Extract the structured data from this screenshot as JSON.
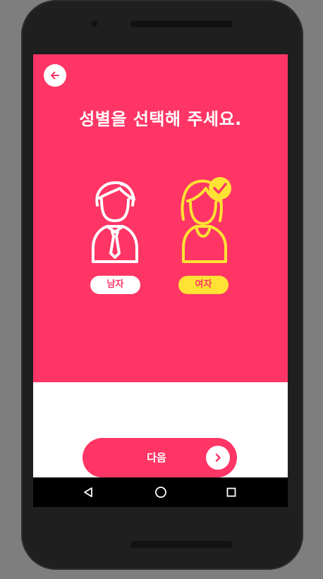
{
  "header": {
    "title": "성별을 선택해 주세요."
  },
  "gender": {
    "options": [
      {
        "label": "남자",
        "selected": false
      },
      {
        "label": "여자",
        "selected": true
      }
    ]
  },
  "footer": {
    "next_label": "다음"
  },
  "colors": {
    "primary": "#fe3565",
    "selected": "#ffe234",
    "white": "#ffffff"
  },
  "icons": {
    "back": "arrow-left-icon",
    "check": "check-badge-icon",
    "next": "chevron-right-icon",
    "nav_back": "nav-back-triangle-icon",
    "nav_home": "nav-home-circle-icon",
    "nav_recent": "nav-recent-square-icon"
  }
}
